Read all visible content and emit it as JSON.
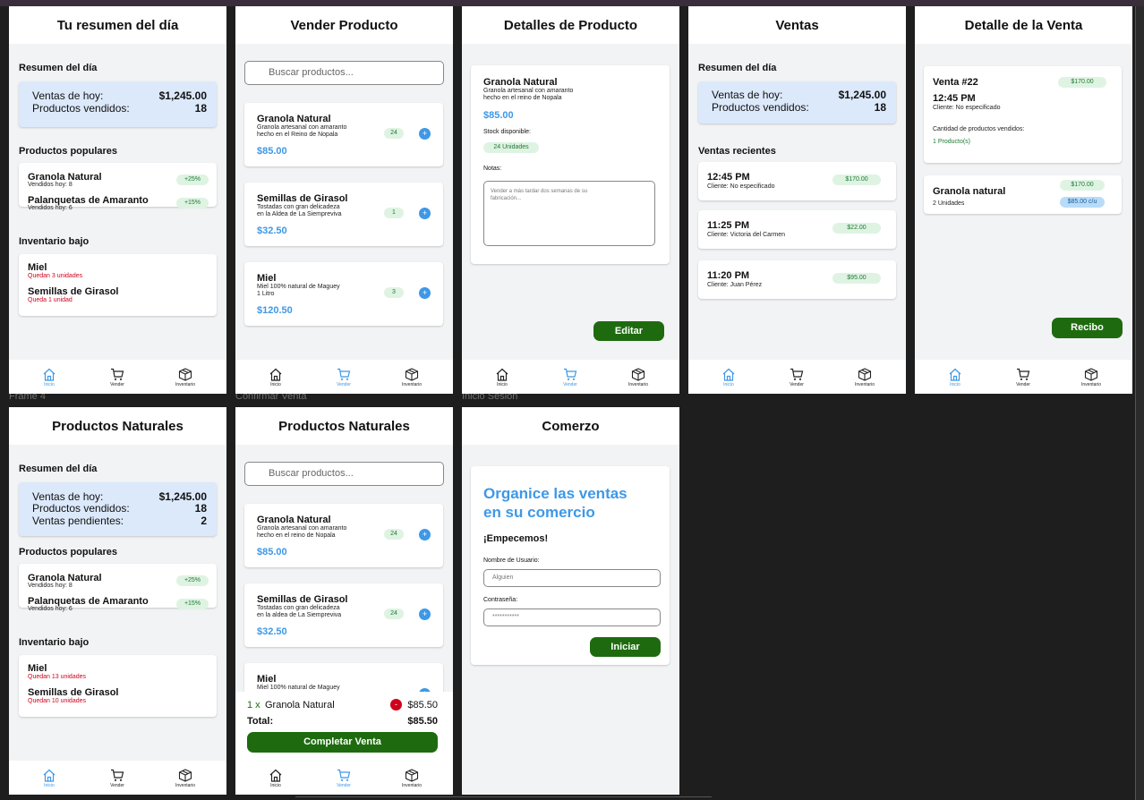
{
  "labels": {
    "frame4": "Frame 4",
    "confirm": "Confirmar Venta",
    "login": "Inicio Sesion"
  },
  "nav": {
    "home": "Inicio",
    "sell": "Vender",
    "inventory": "Inventario"
  },
  "f1": {
    "title": "Tu resumen del día",
    "summary_title": "Resumen del día",
    "sales_today_label": "Ventas de hoy:",
    "sales_today_value": "$1,245.00",
    "products_sold_label": "Productos vendidos:",
    "products_sold_value": "18",
    "popular_title": "Productos populares",
    "popular": [
      {
        "name": "Granola Natural",
        "sub": "Vendidos hoy: 8",
        "badge": "+25%"
      },
      {
        "name": "Palanquetas de Amaranto",
        "sub": "Vendidos hoy: 6",
        "badge": "+15%"
      }
    ],
    "low_title": "Inventario bajo",
    "low": [
      {
        "name": "Miel",
        "sub": "Quedan 3 unidades"
      },
      {
        "name": "Semillas de Girasol",
        "sub": "Queda 1 unidad"
      }
    ]
  },
  "f2": {
    "title": "Vender Producto",
    "search_placeholder": "Buscar productos...",
    "products": [
      {
        "name": "Granola Natural",
        "d1": "Granola artesanal con amaranto",
        "d2": "hecho en el Reino de Nopala",
        "price": "$85.00",
        "stock": "24"
      },
      {
        "name": "Semillas de Girasol",
        "d1": "Tostadas con gran delicadeza",
        "d2": "en la Aldea de La Siempreviva",
        "price": "$32.50",
        "stock": "1"
      },
      {
        "name": "Miel",
        "d1": "Miel 100% natural de Maguey",
        "d2": "1 Litro",
        "price": "$120.50",
        "stock": "3"
      }
    ]
  },
  "f3": {
    "title": "Detalles de Producto",
    "name": "Granola Natural",
    "d1": "Granola artesanal con amaranto",
    "d2": "hecho en el reino de Nopala",
    "price": "$85.00",
    "stock_label": "Stock disponible:",
    "stock_value": "24 Unidades",
    "notes_label": "Notas:",
    "notes_text": "Vender a más tardar dos semanas de su fabricación...",
    "edit": "Editar"
  },
  "f4": {
    "title": "Ventas",
    "summary_title": "Resumen del día",
    "sales_today_label": "Ventas de hoy:",
    "sales_today_value": "$1,245.00",
    "products_sold_label": "Productos vendidos:",
    "products_sold_value": "18",
    "recent_title": "Ventas recientes",
    "recent": [
      {
        "time": "12:45 PM",
        "client": "Cliente: No especificado",
        "amount": "$170.00"
      },
      {
        "time": "11:25 PM",
        "client": "Cliente: Victoria del Carmen",
        "amount": "$22.00"
      },
      {
        "time": "11:20 PM",
        "client": "Cliente: Juan Pérez",
        "amount": "$95.00"
      }
    ]
  },
  "f5": {
    "title": "Detalle de la Venta",
    "sale_no": "Venta #22",
    "amount": "$170.00",
    "time": "12:45 PM",
    "client": "Cliente: No especificado",
    "qty_label": "Cantidad de productos vendidos:",
    "qty_value": "1 Producto(s)",
    "item_name": "Granola natural",
    "item_units": "2 Unidades",
    "item_total": "$170.00",
    "item_unit_price": "$85.00 c/u",
    "receipt": "Recibo"
  },
  "f6": {
    "title": "Productos Naturales",
    "summary_title": "Resumen del día",
    "sales_today_label": "Ventas de hoy:",
    "sales_today_value": "$1,245.00",
    "products_sold_label": "Productos vendidos:",
    "products_sold_value": "18",
    "pending_label": "Ventas pendientes:",
    "pending_value": "2",
    "popular_title": "Productos populares",
    "popular": [
      {
        "name": "Granola Natural",
        "sub": "Vendidos hoy: 8",
        "badge": "+25%"
      },
      {
        "name": "Palanquetas de Amaranto",
        "sub": "Vendidos hoy: 6",
        "badge": "+15%"
      }
    ],
    "low_title": "Inventario bajo",
    "low": [
      {
        "name": "Miel",
        "sub": "Quedan 13 unidades"
      },
      {
        "name": "Semillas de Girasol",
        "sub": "Quedan 10 unidades"
      }
    ]
  },
  "f7": {
    "title": "Productos Naturales",
    "search_placeholder": "Buscar productos...",
    "products": [
      {
        "name": "Granola Natural",
        "d1": "Granola artesanal con amaranto",
        "d2": "hecho en el reino de Nopala",
        "price": "$85.00",
        "stock": "24"
      },
      {
        "name": "Semillas de Girasol",
        "d1": "Tostadas con gran delicadeza",
        "d2": "en la aldea de La Siempreviva",
        "price": "$32.50",
        "stock": "24"
      },
      {
        "name": "Miel",
        "d1": "Miel 100% natural de Maguey"
      }
    ],
    "cart_qty": "1 x",
    "cart_item": "Granola Natural",
    "cart_price": "$85.50",
    "total_label": "Total:",
    "total_value": "$85.50",
    "complete": "Completar Venta"
  },
  "f8": {
    "title": "Comerzo",
    "headline1": "Organice las ventas",
    "headline2": "en su comercio",
    "start": "¡Empecemos!",
    "user_label": "Nombre de Usuario:",
    "user_placeholder": "Alguien",
    "pass_label": "Contraseña:",
    "pass_value": "***********",
    "login": "Iniciar"
  }
}
